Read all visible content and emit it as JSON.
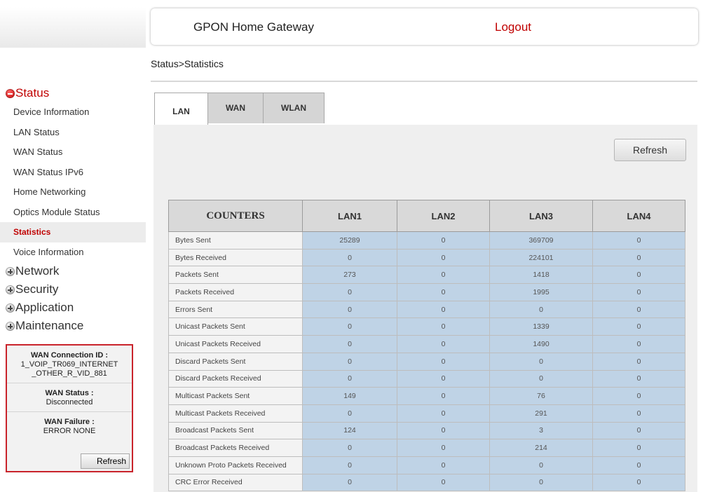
{
  "header": {
    "title": "GPON Home Gateway",
    "logout": "Logout"
  },
  "breadcrumb": "Status>Statistics",
  "sidebar": {
    "status_label": "Status",
    "status_items": [
      "Device Information",
      "LAN Status",
      "WAN Status",
      "WAN Status IPv6",
      "Home Networking",
      "Optics Module Status",
      "Statistics",
      "Voice Information"
    ],
    "active_item": "Statistics",
    "sections": [
      "Network",
      "Security",
      "Application",
      "Maintenance"
    ]
  },
  "wan_box": {
    "connection_label": "WAN Connection ID :",
    "connection_value": "1_VOIP_TR069_INTERNET _OTHER_R_VID_881",
    "status_label": "WAN Status :",
    "status_value": "Disconnected",
    "failure_label": "WAN Failure :",
    "failure_value": "ERROR NONE",
    "refresh": "Refresh"
  },
  "tabs": [
    "LAN",
    "WAN",
    "WLAN"
  ],
  "active_tab": "LAN",
  "refresh_button": "Refresh",
  "table": {
    "headers": [
      "COUNTERS",
      "LAN1",
      "LAN2",
      "LAN3",
      "LAN4"
    ],
    "rows": [
      [
        "Bytes Sent",
        "25289",
        "0",
        "369709",
        "0"
      ],
      [
        "Bytes Received",
        "0",
        "0",
        "224101",
        "0"
      ],
      [
        "Packets Sent",
        "273",
        "0",
        "1418",
        "0"
      ],
      [
        "Packets Received",
        "0",
        "0",
        "1995",
        "0"
      ],
      [
        "Errors Sent",
        "0",
        "0",
        "0",
        "0"
      ],
      [
        "Unicast Packets Sent",
        "0",
        "0",
        "1339",
        "0"
      ],
      [
        "Unicast Packets Received",
        "0",
        "0",
        "1490",
        "0"
      ],
      [
        "Discard Packets Sent",
        "0",
        "0",
        "0",
        "0"
      ],
      [
        "Discard Packets Received",
        "0",
        "0",
        "0",
        "0"
      ],
      [
        "Multicast Packets Sent",
        "149",
        "0",
        "76",
        "0"
      ],
      [
        "Multicast Packets Received",
        "0",
        "0",
        "291",
        "0"
      ],
      [
        "Broadcast Packets Sent",
        "124",
        "0",
        "3",
        "0"
      ],
      [
        "Broadcast Packets Received",
        "0",
        "0",
        "214",
        "0"
      ],
      [
        "Unknown Proto Packets Received",
        "0",
        "0",
        "0",
        "0"
      ],
      [
        "CRC Error Received",
        "0",
        "0",
        "0",
        "0"
      ]
    ]
  },
  "icons": {
    "status": "collapse-icon",
    "sections": "expand-icon"
  },
  "colors": {
    "accent_red": "#c00000",
    "cell_blue": "#bfd3e6",
    "box_border": "#c9232b"
  }
}
